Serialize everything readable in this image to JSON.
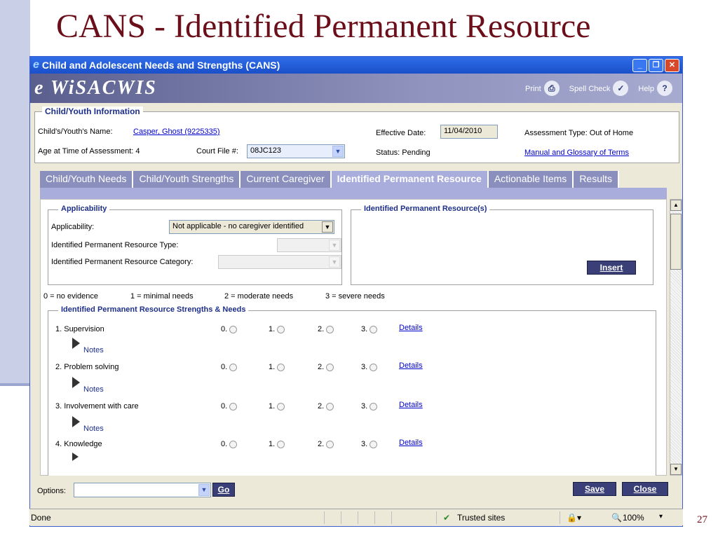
{
  "slide": {
    "title": "CANS - Identified Permanent Resource",
    "page_number": "27"
  },
  "window": {
    "title": "Child and Adolescent Needs and Strengths (CANS)"
  },
  "banner": {
    "logo": "e WiSACWIS",
    "print": "Print",
    "spell_check": "Spell Check",
    "help": "Help"
  },
  "info": {
    "legend": "Child/Youth Information",
    "name_label": "Child's/Youth's Name:",
    "name_value": "Casper, Ghost (9225335)",
    "age_label": "Age at Time of Assessment: 4",
    "court_label": "Court File #:",
    "court_value": "08JC123",
    "effective_label": "Effective Date:",
    "effective_value": "11/04/2010",
    "status_label": "Status: Pending",
    "assessment_type": "Assessment Type: Out of Home",
    "manual_link": "Manual and Glossary of Terms"
  },
  "tabs": [
    "Child/Youth Needs",
    "Child/Youth Strengths",
    "Current Caregiver",
    "Identified Permanent Resource",
    "Actionable Items",
    "Results"
  ],
  "applicability": {
    "legend": "Applicability",
    "app_label": "Applicability:",
    "app_value": "Not applicable - no caregiver identified",
    "type_label": "Identified Permanent Resource Type:",
    "category_label": "Identified Permanent Resource Category:"
  },
  "resources": {
    "legend": "Identified Permanent Resource(s)",
    "insert": "Insert"
  },
  "scale": [
    "0 = no evidence",
    "1 = minimal needs",
    "2 = moderate needs",
    "3 = severe needs"
  ],
  "strengths": {
    "legend": "Identified Permanent Resource Strengths & Needs",
    "options": [
      "0.",
      "1.",
      "2.",
      "3."
    ],
    "details": "Details",
    "notes": "Notes",
    "items": [
      "1. Supervision",
      "2. Problem solving",
      "3. Involvement with care",
      "4. Knowledge"
    ]
  },
  "footer": {
    "options_label": "Options:",
    "go": "Go",
    "save": "Save",
    "close": "Close"
  },
  "statusbar": {
    "status": "Done",
    "zone": "Trusted sites",
    "zoom": "100%"
  }
}
